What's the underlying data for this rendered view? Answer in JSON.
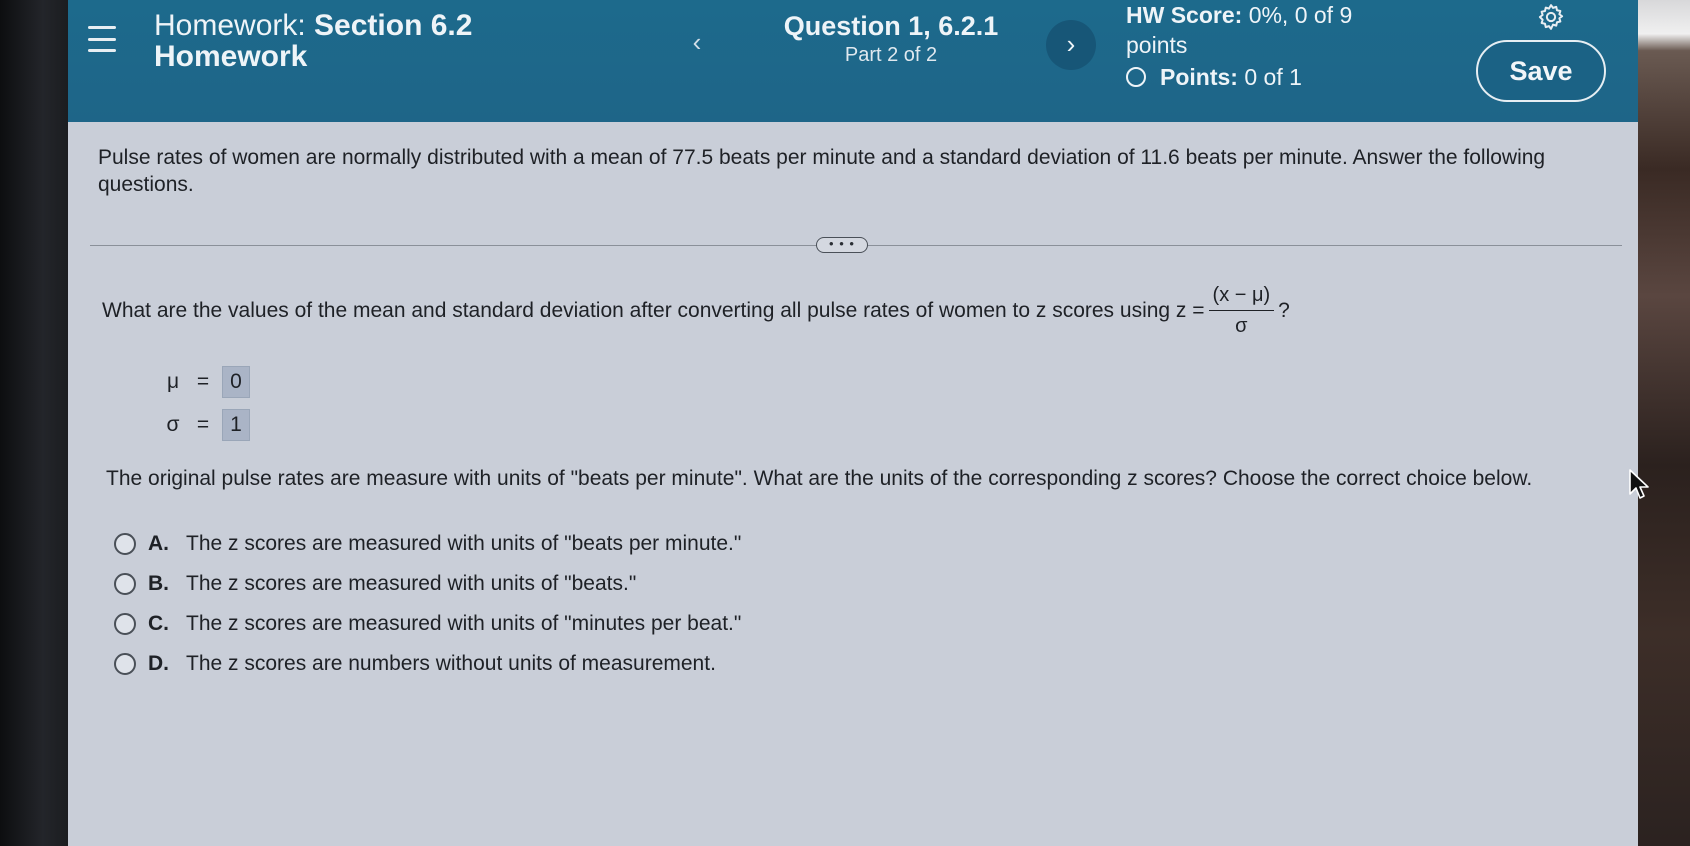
{
  "header": {
    "title_prefix": "Homework:",
    "title_section": "Section 6.2",
    "title_line2": "Homework",
    "prev_icon": "chevron-left-icon",
    "prev_glyph": "‹",
    "question_title": "Question 1, 6.2.1",
    "question_part": "Part 2 of 2",
    "next_icon": "chevron-right-icon",
    "next_glyph": "›",
    "hw_score_label": "HW Score:",
    "hw_score_value": "0%, 0 of 9",
    "hw_score_unit": "points",
    "points_label": "Points:",
    "points_value": "0 of 1",
    "save_label": "Save",
    "settings_icon": "gear-icon",
    "menu_icon": "hamburger-menu-icon"
  },
  "intro": {
    "text": "Pulse rates of women are normally distributed with a mean of 77.5 beats per minute and a standard deviation of 11.6 beats per minute. Answer the following questions."
  },
  "more_button": {
    "label": "• • •"
  },
  "question2": {
    "text": "What are the values of the mean and standard deviation after converting all pulse rates of women to z scores using z =",
    "fraction_numerator": "(x − μ)",
    "fraction_denominator": "σ",
    "suffix": "?"
  },
  "answers": {
    "mu_symbol": "μ",
    "mu_eq": "=",
    "mu_value": "0",
    "sigma_symbol": "σ",
    "sigma_eq": "=",
    "sigma_value": "1"
  },
  "question3": {
    "text": "The original pulse rates are measure with units of \"beats per minute\". What are the units of the corresponding z scores? Choose the correct choice below."
  },
  "choices": [
    {
      "letter": "A.",
      "text": "The z scores are measured with units of \"beats per minute.\""
    },
    {
      "letter": "B.",
      "text": "The z scores are measured with units of \"beats.\""
    },
    {
      "letter": "C.",
      "text": "The z scores are measured with units of \"minutes per beat.\""
    },
    {
      "letter": "D.",
      "text": "The z scores are numbers without units of measurement."
    }
  ],
  "colors": {
    "header_bg": "#1d6a8c",
    "content_bg": "#c9ced8",
    "answer_box": "#aab4c6"
  }
}
